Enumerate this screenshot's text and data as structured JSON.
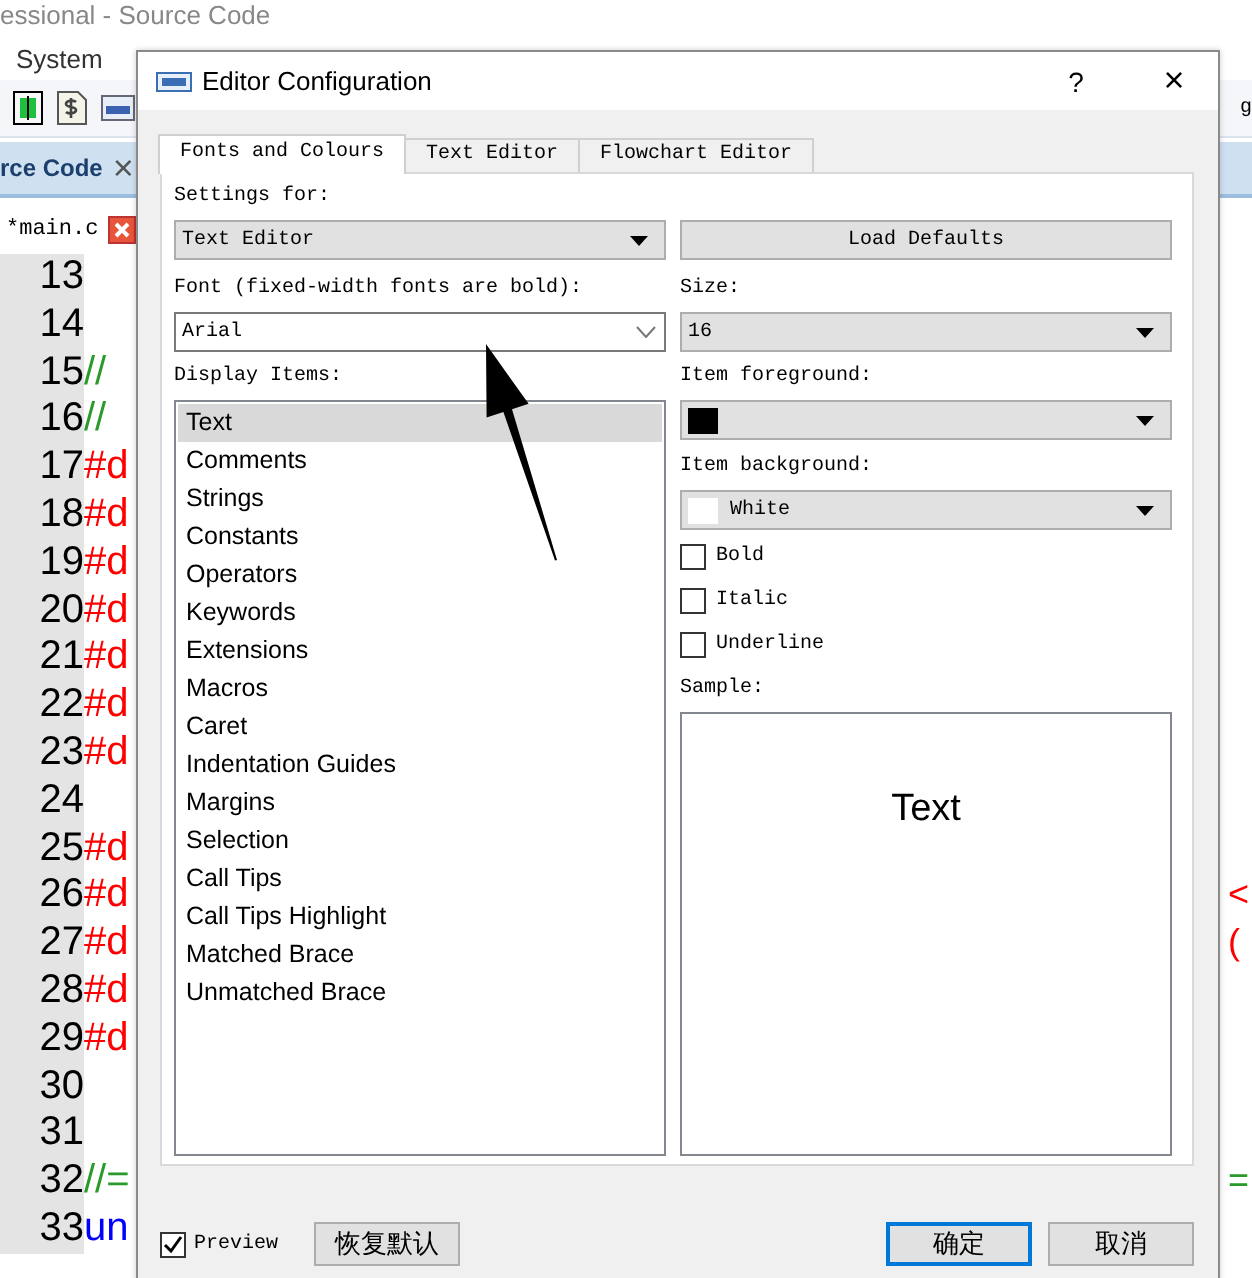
{
  "app": {
    "title": "essional - Source Code",
    "menu": [
      "System"
    ],
    "toolbar_fragment": "g",
    "doc_tab": {
      "label": "rce Code",
      "close": "×"
    },
    "file_tab": {
      "label": "*main.c"
    },
    "lines": [
      {
        "number": "13"
      },
      {
        "number": "14"
      },
      {
        "number": "15",
        "code": "//",
        "kind": "comment"
      },
      {
        "number": "16",
        "code": "//",
        "kind": "comment"
      },
      {
        "number": "17",
        "code": "#d",
        "kind": "directive"
      },
      {
        "number": "18",
        "code": "#d",
        "kind": "directive"
      },
      {
        "number": "19",
        "code": "#d",
        "kind": "directive"
      },
      {
        "number": "20",
        "code": "#d",
        "kind": "directive"
      },
      {
        "number": "21",
        "code": "#d",
        "kind": "directive"
      },
      {
        "number": "22",
        "code": "#d",
        "kind": "directive"
      },
      {
        "number": "23",
        "code": "#d",
        "kind": "directive"
      },
      {
        "number": "24"
      },
      {
        "number": "25",
        "code": "#d",
        "kind": "directive"
      },
      {
        "number": "26",
        "code": "#d",
        "kind": "directive",
        "right": "<"
      },
      {
        "number": "27",
        "code": "#d",
        "kind": "directive",
        "right": "("
      },
      {
        "number": "28",
        "code": "#d",
        "kind": "directive"
      },
      {
        "number": "29",
        "code": "#d",
        "kind": "directive"
      },
      {
        "number": "30"
      },
      {
        "number": "31"
      },
      {
        "number": "32",
        "code": "//=",
        "kind": "comment",
        "right": "="
      },
      {
        "number": "33",
        "code": "un",
        "kind": "keyword"
      }
    ]
  },
  "dialog": {
    "title": "Editor Configuration",
    "help": "?",
    "close": "×",
    "tabs": [
      {
        "label": "Fonts and Colours",
        "selected": true
      },
      {
        "label": "Text Editor",
        "selected": false
      },
      {
        "label": "Flowchart Editor",
        "selected": false
      }
    ],
    "settings_for": {
      "label": "Settings for:",
      "value": "Text Editor"
    },
    "load_defaults": "Load Defaults",
    "font": {
      "label": "Font (fixed-width fonts are bold):",
      "value": "Arial"
    },
    "size": {
      "label": "Size:",
      "value": "16"
    },
    "display_items": {
      "label": "Display Items:",
      "items": [
        {
          "label": "Text",
          "selected": true
        },
        {
          "label": "Comments",
          "selected": false
        },
        {
          "label": "Strings",
          "selected": false
        },
        {
          "label": "Constants",
          "selected": false
        },
        {
          "label": "Operators",
          "selected": false
        },
        {
          "label": "Keywords",
          "selected": false
        },
        {
          "label": "Extensions",
          "selected": false
        },
        {
          "label": "Macros",
          "selected": false
        },
        {
          "label": "Caret",
          "selected": false
        },
        {
          "label": "Indentation Guides",
          "selected": false
        },
        {
          "label": "Margins",
          "selected": false
        },
        {
          "label": "Selection",
          "selected": false
        },
        {
          "label": "Call Tips",
          "selected": false
        },
        {
          "label": "Call Tips Highlight",
          "selected": false
        },
        {
          "label": "Matched Brace",
          "selected": false
        },
        {
          "label": "Unmatched Brace",
          "selected": false
        }
      ]
    },
    "foreground": {
      "label": "Item foreground:",
      "color": "#000000"
    },
    "background": {
      "label": "Item background:",
      "color": "#ffffff",
      "value": "White"
    },
    "styles": [
      {
        "label": "Bold",
        "checked": false
      },
      {
        "label": "Italic",
        "checked": false
      },
      {
        "label": "Underline",
        "checked": false
      }
    ],
    "sample": {
      "label": "Sample:",
      "text": "Text"
    },
    "preview": {
      "label": "Preview",
      "checked": true
    },
    "restore": "恢复默认",
    "ok": {
      "label": "确定",
      "focused": true
    },
    "cancel": "取消"
  }
}
